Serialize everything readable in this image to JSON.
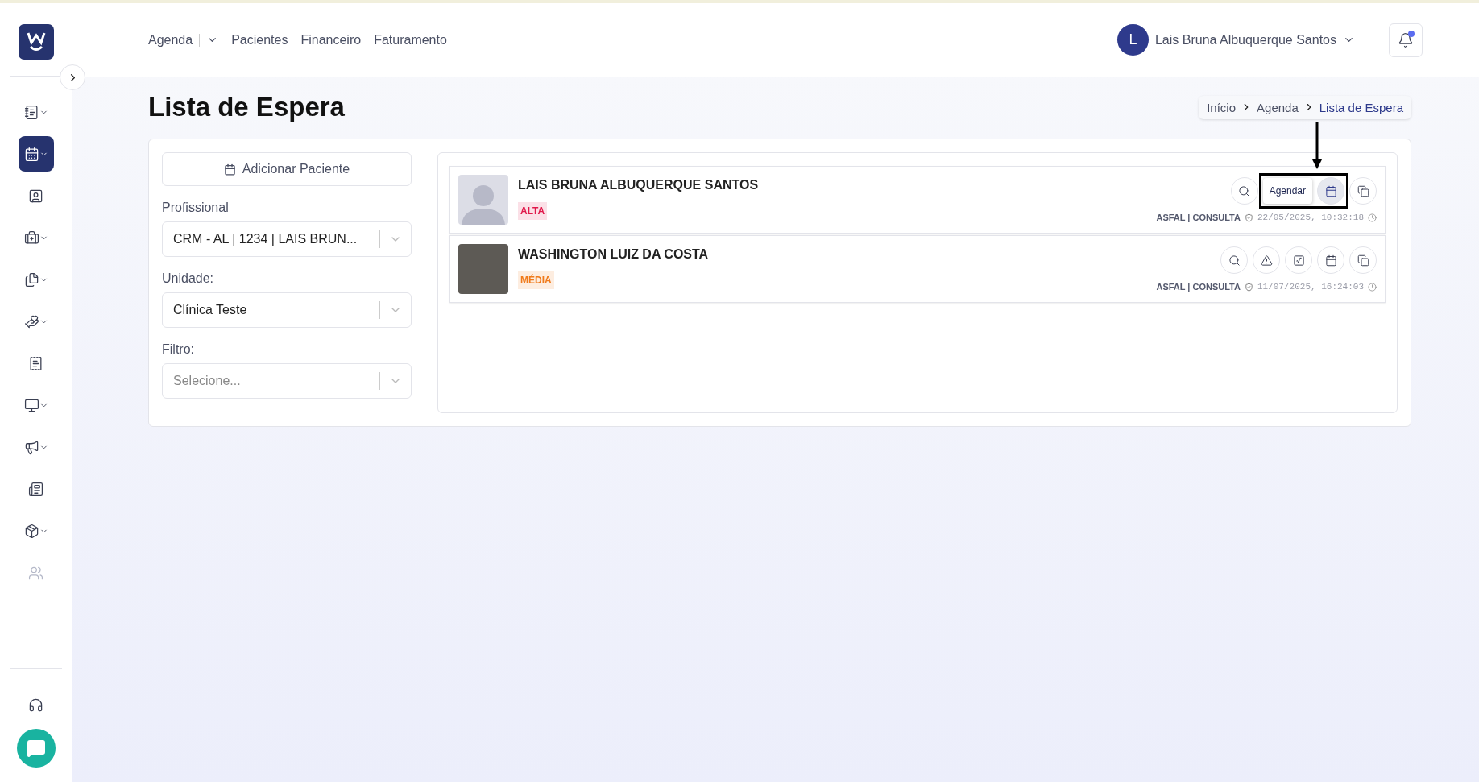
{
  "sidebar": {
    "items": [
      {
        "has_menu": true,
        "selected": false,
        "disabled": false
      },
      {
        "has_menu": true,
        "selected": true,
        "disabled": false
      },
      {
        "has_menu": false,
        "selected": false,
        "disabled": false
      },
      {
        "has_menu": true,
        "selected": false,
        "disabled": false
      },
      {
        "has_menu": true,
        "selected": false,
        "disabled": false
      },
      {
        "has_menu": true,
        "selected": false,
        "disabled": false
      },
      {
        "has_menu": false,
        "selected": false,
        "disabled": false
      },
      {
        "has_menu": true,
        "selected": false,
        "disabled": false
      },
      {
        "has_menu": true,
        "selected": false,
        "disabled": false
      },
      {
        "has_menu": false,
        "selected": false,
        "disabled": false
      },
      {
        "has_menu": true,
        "selected": false,
        "disabled": false
      },
      {
        "has_menu": false,
        "selected": false,
        "disabled": true
      }
    ]
  },
  "nav": [
    {
      "label": "Agenda",
      "has_menu": true
    },
    {
      "label": "Pacientes",
      "has_menu": false
    },
    {
      "label": "Financeiro",
      "has_menu": false
    },
    {
      "label": "Faturamento",
      "has_menu": false
    }
  ],
  "user": {
    "initial": "L",
    "name": "Lais Bruna Albuquerque Santos",
    "has_notification": true
  },
  "page_title": "Lista de Espera",
  "breadcrumb": [
    {
      "label": "Início",
      "selected": false
    },
    {
      "label": "Agenda",
      "selected": false
    },
    {
      "label": "Lista de Espera",
      "selected": true
    }
  ],
  "add_button": "Adicionar Paciente",
  "filters": [
    {
      "label": "Profissional",
      "value": "CRM - AL | 1234 | LAIS BRUN..."
    },
    {
      "label": "Unidade:",
      "value": "Clínica Teste"
    },
    {
      "label": "Filtro:",
      "placeholder": "Selecione..."
    }
  ],
  "patients": [
    {
      "name": "LAIS BRUNA ALBUQUERQUE SANTOS",
      "has_photo": false,
      "priority": {
        "label": "ALTA",
        "color": "#e0184a"
      },
      "service": "ASFAL | CONSULTA",
      "datetime": "22/05/2025, 10:32:18",
      "tooltip": "Agendar",
      "highlighted": true,
      "actions": [
        {
          "kind": "search",
          "hovered": false
        },
        {
          "kind": "calendar",
          "hovered": true
        },
        {
          "kind": "copy",
          "hovered": false
        }
      ]
    },
    {
      "name": "WASHINGTON LUIZ DA COSTA",
      "has_photo": true,
      "priority": {
        "label": "MÉDIA",
        "color": "#f07a1a"
      },
      "service": "ASFAL | CONSULTA",
      "datetime": "11/07/2025, 16:24:03",
      "actions": [
        {
          "kind": "search",
          "hovered": false
        },
        {
          "kind": "warning",
          "hovered": false
        },
        {
          "kind": "formula",
          "hovered": false
        },
        {
          "kind": "calendar",
          "hovered": false
        },
        {
          "kind": "copy",
          "hovered": false
        }
      ]
    }
  ]
}
